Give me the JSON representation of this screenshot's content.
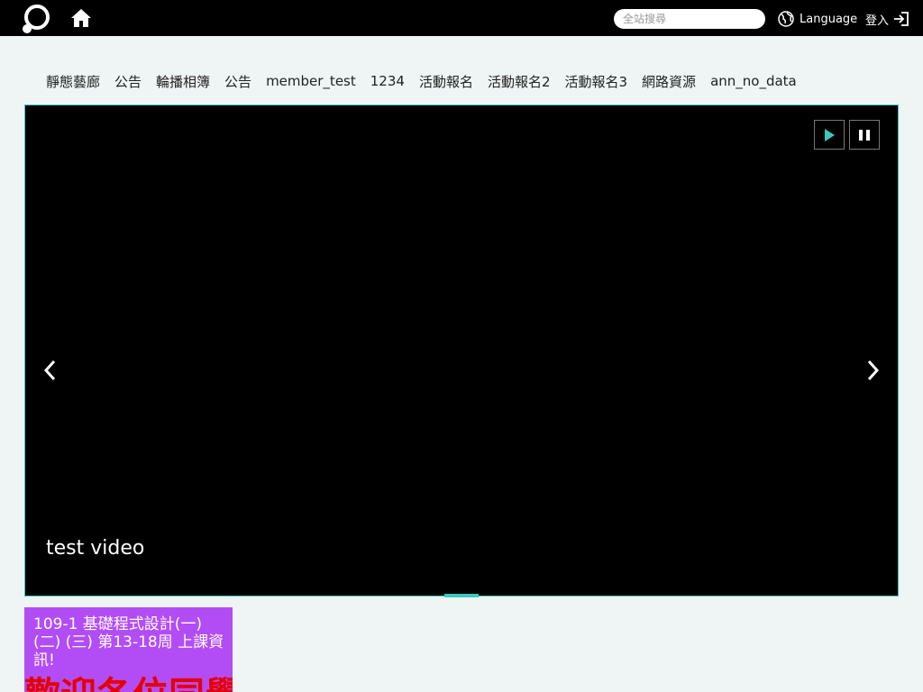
{
  "header": {
    "search_placeholder": "全站搜尋",
    "language_label": "Language",
    "login_label": "登入"
  },
  "nav": {
    "items": [
      "靜態藝廊",
      "公告",
      "輪播相簿",
      "公告",
      "member_test",
      "1234",
      "活動報名",
      "活動報名2",
      "活動報名3",
      "網路資源",
      "ann_no_data"
    ]
  },
  "carousel": {
    "caption": "test video",
    "active_slide": 1,
    "slide_count": 1
  },
  "card": {
    "title": "109-1 基礎程式設計(一)(二) (三) 第13-18周 上課資訊!",
    "big_text": "歡迎各位同學"
  },
  "colors": {
    "accent": "#3cc9bd",
    "card_bg": "#b24df5",
    "card_big_text": "#e60000",
    "page_bg": "#eef5f4"
  },
  "icons": [
    "logo-icon",
    "home-icon",
    "globe-icon",
    "login-icon",
    "play-icon",
    "pause-icon",
    "chevron-left-icon",
    "chevron-right-icon"
  ]
}
